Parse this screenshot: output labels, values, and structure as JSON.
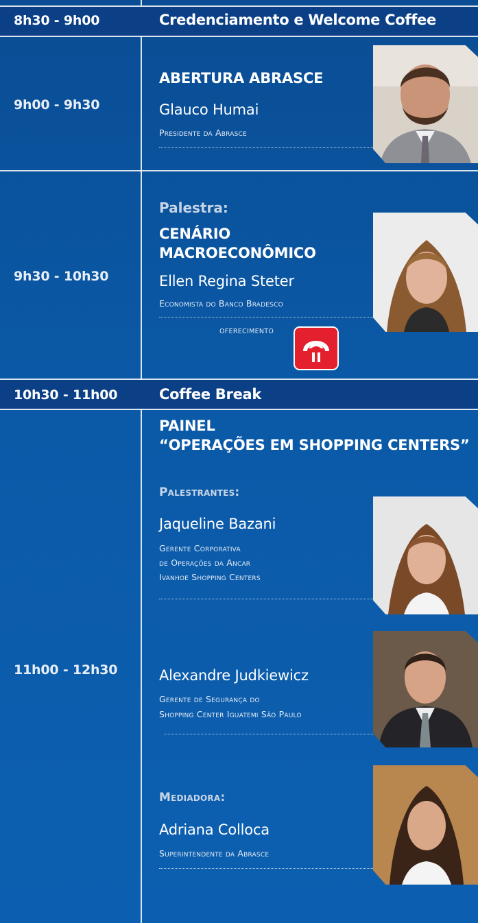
{
  "rows": {
    "r1": {
      "time": "8h30 - 9h00",
      "title": "Credenciamento e Welcome Coffee"
    },
    "r2": {
      "time": "9h00 - 9h30",
      "heading": "ABERTURA ABRASCE",
      "name": "Glauco Humai",
      "role": [
        {
          "c": "P"
        },
        {
          "t": "RESIDENTE DA "
        },
        {
          "c": "A"
        },
        {
          "t": "BRASCE"
        }
      ]
    },
    "r3": {
      "time": "9h30 - 10h30",
      "kicker": "Palestra:",
      "heading1": "CENÁRIO",
      "heading2": "MACROECONÔMICO",
      "name": "Ellen Regina Steter",
      "role_text": "Economista do Banco Bradesco",
      "sponsor_label": "OFERECIMENTO"
    },
    "r4": {
      "time": "10h30 - 11h00",
      "title": "Coffee Break"
    },
    "r5": {
      "time": "11h00 - 12h30",
      "heading1": "PAINEL",
      "heading2": "“OPERAÇÕES EM SHOPPING CENTERS”",
      "speakers_label": "Palestrantes:",
      "s1_name": "Jaqueline Bazani",
      "s1_role1": "Gerente Corporativa",
      "s1_role2": "de Operações da Ancar",
      "s1_role3": "Ivanhoe Shopping Centers",
      "s2_name": "Alexandre Judkiewicz",
      "s2_role1": "Gerente de Segurança do",
      "s2_role2": "Shopping Center Iguatemi São Paulo",
      "moderator_label": "Mediadora:",
      "s3_name": "Adriana Colloca",
      "s3_role1": "Superintendente da Abrasce"
    }
  },
  "colors": {
    "background": "#0b5aa8",
    "band": "#0b3f86",
    "sponsor_logo": "#e4202f"
  }
}
